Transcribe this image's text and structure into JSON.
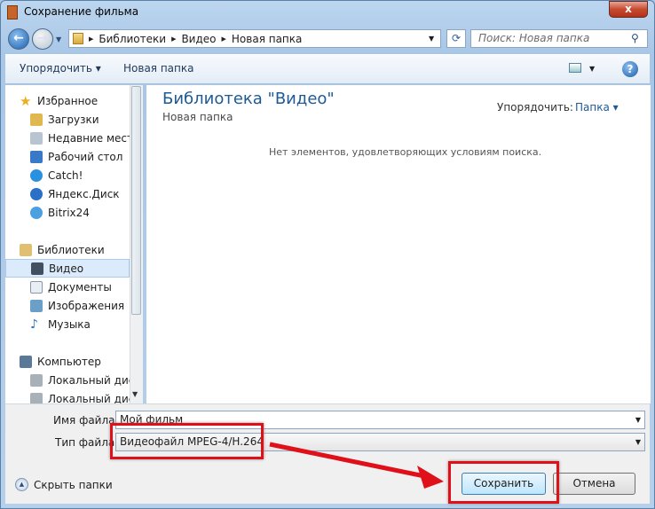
{
  "window": {
    "title": "Сохранение фильма",
    "close": "x"
  },
  "address": {
    "crumbs": [
      "Библиотеки",
      "Видео",
      "Новая папка"
    ],
    "search_placeholder": "Поиск: Новая папка"
  },
  "toolbar": {
    "organize": "Упорядочить ▾",
    "new_folder": "Новая папка"
  },
  "sidebar": {
    "favorites": {
      "label": "Избранное",
      "items": [
        "Загрузки",
        "Недавние места",
        "Рабочий стол",
        "Catch!",
        "Яндекс.Диск",
        "Bitrix24"
      ]
    },
    "libraries": {
      "label": "Библиотеки",
      "items": [
        "Видео",
        "Документы",
        "Изображения",
        "Музыка"
      ]
    },
    "computer": {
      "label": "Компьютер",
      "items": [
        "Локальный диск",
        "Локальный диск"
      ]
    }
  },
  "content": {
    "title": "Библиотека \"Видео\"",
    "subtitle": "Новая папка",
    "arrange_label": "Упорядочить:",
    "arrange_value": "Папка ▾",
    "empty_message": "Нет элементов, удовлетворяющих условиям поиска."
  },
  "form": {
    "filename_label": "Имя файла:",
    "filename_value": "Мой фильм",
    "filetype_label": "Тип файла:",
    "filetype_value": "Видеофайл MPEG-4/H.264"
  },
  "buttons": {
    "hide_folders": "Скрыть папки",
    "save": "Сохранить",
    "cancel": "Отмена"
  },
  "colors": {
    "highlight": "#e0101a",
    "title_blue": "#1e5a96"
  }
}
